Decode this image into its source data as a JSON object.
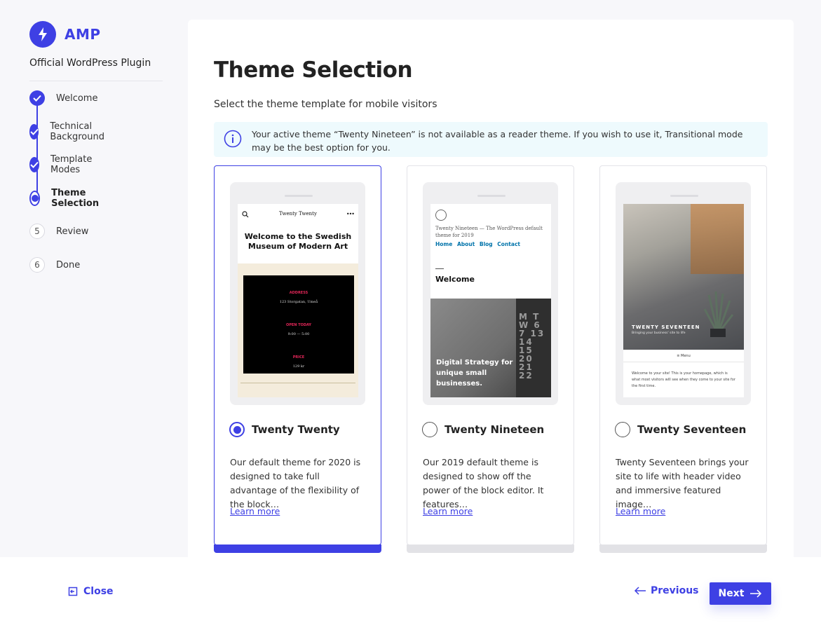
{
  "brand": {
    "name": "AMP",
    "subtitle": "Official WordPress Plugin",
    "logo_icon": "lightning-bolt-icon",
    "accent_color": "#3e40e4"
  },
  "steps": [
    {
      "number": "1",
      "label": "Welcome",
      "state": "done"
    },
    {
      "number": "2",
      "label": "Technical Background",
      "state": "done"
    },
    {
      "number": "3",
      "label": "Template Modes",
      "state": "done"
    },
    {
      "number": "4",
      "label": "Theme Selection",
      "state": "current"
    },
    {
      "number": "5",
      "label": "Review",
      "state": "todo"
    },
    {
      "number": "6",
      "label": "Done",
      "state": "todo"
    }
  ],
  "main": {
    "title": "Theme Selection",
    "subtitle": "Select the theme template for mobile visitors",
    "notice": "Your active theme “Twenty Nineteen” is not available as a reader theme. If you wish to use it, Transitional mode may be the best option for you.",
    "notice_icon": "info-icon"
  },
  "themes": [
    {
      "name": "Twenty Twenty",
      "selected": true,
      "description": "Our default theme for 2020 is designed to take full advantage of the flexibility of the block…",
      "learn_more": "Learn more",
      "preview": {
        "brand": "Twenty Twenty",
        "heading": "Welcome to the Swedish Museum of Modern Art",
        "menu": "•••",
        "rows": [
          {
            "label": "ADDRESS",
            "value": "123 Storgatan, Umeå"
          },
          {
            "label": "OPEN TODAY",
            "value": "9:00 — 5:00"
          },
          {
            "label": "PRICE",
            "value": "129 kr"
          }
        ]
      }
    },
    {
      "name": "Twenty Nineteen",
      "selected": false,
      "description": "Our 2019 default theme is designed to show off the power of the block editor. It features…",
      "learn_more": "Learn more",
      "preview": {
        "site": "Twenty Nineteen — The WordPress default theme for 2019",
        "nav": [
          "Home",
          "About",
          "Blog",
          "Contact"
        ],
        "heading": "Welcome",
        "calendar": "M T W 6 7 13 14 15 20 21 22",
        "banner": "Digital Strategy for unique small businesses."
      }
    },
    {
      "name": "Twenty Seventeen",
      "selected": false,
      "description": "Twenty Seventeen brings your site to life with header video and immersive featured image…",
      "learn_more": "Learn more",
      "preview": {
        "title": "TWENTY SEVENTEEN",
        "tagline": "Bringing your business' site to life",
        "menu": "≡ Menu",
        "text": "Welcome to your site! This is your homepage, which is what most visitors will see when they come to your site for the first time."
      }
    }
  ],
  "footer": {
    "close_label": "Close",
    "previous_label": "Previous",
    "next_label": "Next"
  }
}
